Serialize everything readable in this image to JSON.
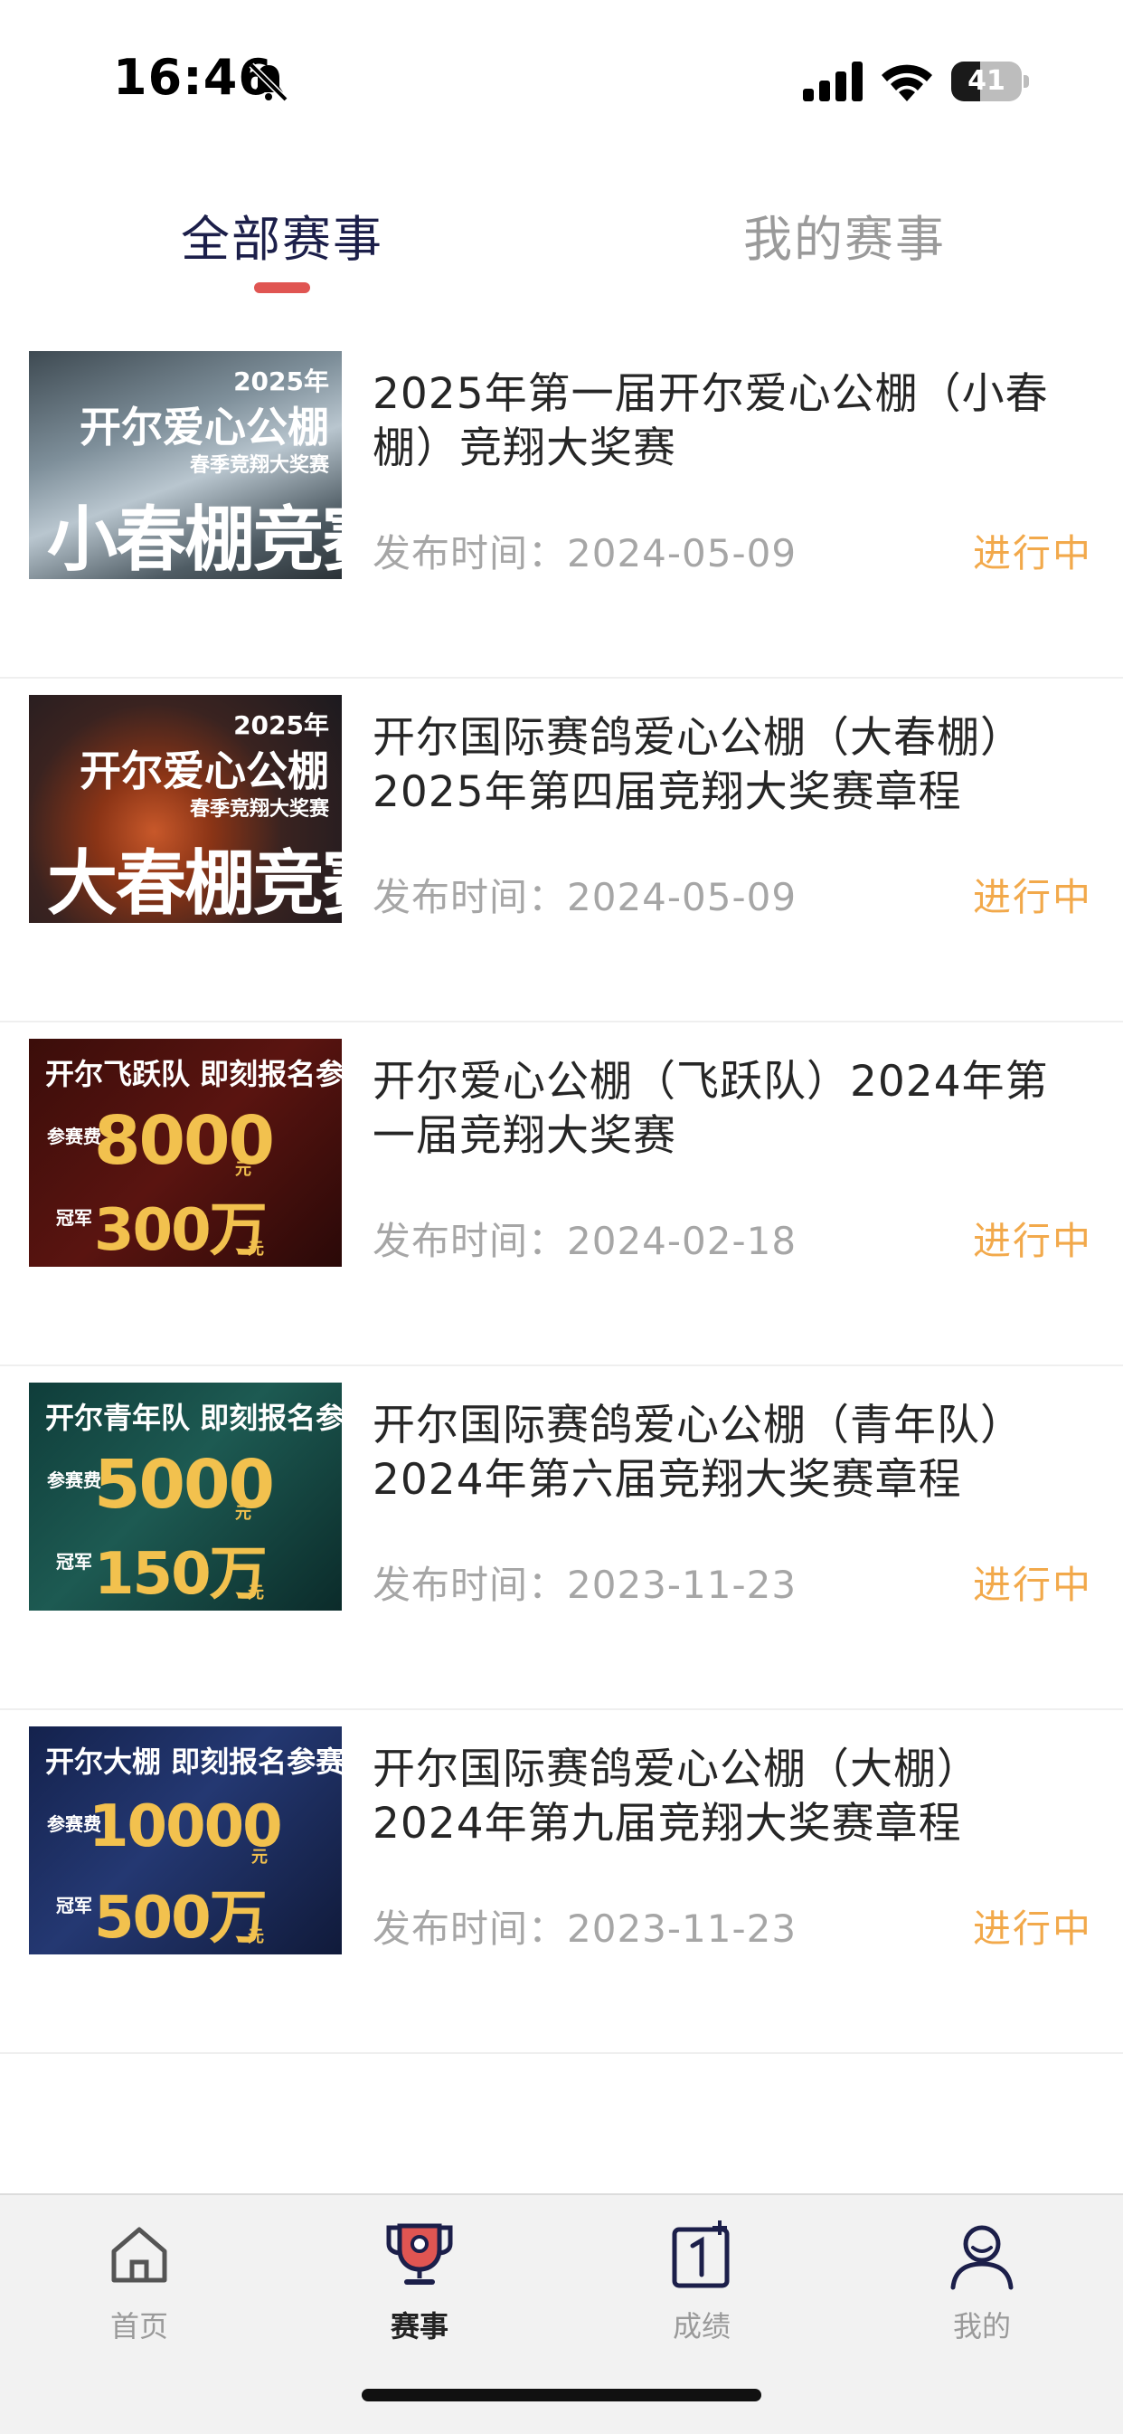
{
  "status_bar": {
    "time": "16:46",
    "battery": "41",
    "battery_level": 0.41
  },
  "tabs": [
    {
      "label": "全部赛事",
      "active": true
    },
    {
      "label": "我的赛事",
      "active": false
    }
  ],
  "events": [
    {
      "title": "2025年第一届开尔爱心公棚（小春棚）竞翔大奖赛",
      "date_label": "发布时间：",
      "date": "2024-05-09",
      "status": "进行中",
      "thumb": {
        "year": "2025年",
        "line1": "开尔爱心公棚",
        "line2": "春季竞翔大奖赛",
        "line3": "小春棚竞赛规程"
      }
    },
    {
      "title": "开尔国际赛鸽爱心公棚（大春棚）2025年第四届竞翔大奖赛章程",
      "date_label": "发布时间：",
      "date": "2024-05-09",
      "status": "进行中",
      "thumb": {
        "year": "2025年",
        "line1": "开尔爱心公棚",
        "line2": "春季竞翔大奖赛",
        "line3": "大春棚竞赛规程"
      }
    },
    {
      "title": "开尔爱心公棚（飞跃队）2024年第一届竞翔大奖赛",
      "date_label": "发布时间：",
      "date": "2024-02-18",
      "status": "进行中",
      "thumb": {
        "heading": "开尔飞跃队 即刻报名参赛",
        "fee_label": "参赛费",
        "fee": "8000",
        "fee_unit": "元",
        "champ_label": "冠军",
        "prize": "300万",
        "prize_unit": "元"
      }
    },
    {
      "title": "开尔国际赛鸽爱心公棚（青年队）2024年第六届竞翔大奖赛章程",
      "date_label": "发布时间：",
      "date": "2023-11-23",
      "status": "进行中",
      "thumb": {
        "heading": "开尔青年队 即刻报名参赛",
        "fee_label": "参赛费",
        "fee": "5000",
        "fee_unit": "元",
        "champ_label": "冠军",
        "prize": "150万",
        "prize_unit": "元"
      }
    },
    {
      "title": "开尔国际赛鸽爱心公棚（大棚）2024年第九届竞翔大奖赛章程",
      "date_label": "发布时间：",
      "date": "2023-11-23",
      "status": "进行中",
      "thumb": {
        "heading": "开尔大棚 即刻报名参赛",
        "fee_label": "参赛费",
        "fee": "10000",
        "fee_unit": "元",
        "champ_label": "冠军",
        "prize": "500万",
        "prize_unit": "元"
      }
    }
  ],
  "bottom_nav": [
    {
      "label": "首页",
      "icon": "home-icon",
      "active": false
    },
    {
      "label": "赛事",
      "icon": "trophy-icon",
      "active": true
    },
    {
      "label": "成绩",
      "icon": "score-icon",
      "active": false
    },
    {
      "label": "我的",
      "icon": "user-icon",
      "active": false
    }
  ],
  "colors": {
    "accent": "#e05552",
    "status": "#f2a94b",
    "tab_active": "#1c1f4a",
    "inactive": "#9a9a9a"
  }
}
